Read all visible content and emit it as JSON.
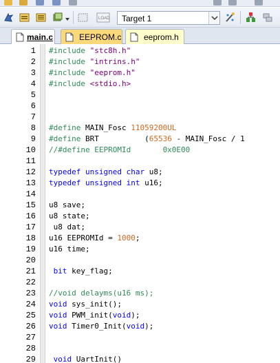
{
  "toolbar": {
    "target": "Target 1"
  },
  "tabs": [
    {
      "label": "main.c",
      "active": true
    },
    {
      "label": "EEPROM.c",
      "active": false
    },
    {
      "label": "eeprom.h",
      "active": false
    }
  ],
  "editor": {
    "lines": [
      {
        "n": "1",
        "tokens": [
          [
            "directive",
            "#include "
          ],
          [
            "string",
            "\"stc8h.h\""
          ]
        ]
      },
      {
        "n": "2",
        "tokens": [
          [
            "directive",
            "#include "
          ],
          [
            "string",
            "\"intrins.h\""
          ]
        ]
      },
      {
        "n": "3",
        "tokens": [
          [
            "directive",
            "#include "
          ],
          [
            "string",
            "\"eeprom.h\""
          ]
        ]
      },
      {
        "n": "4",
        "tokens": [
          [
            "directive",
            "#include "
          ],
          [
            "string",
            "<stdio.h>"
          ]
        ]
      },
      {
        "n": "5",
        "tokens": []
      },
      {
        "n": "6",
        "tokens": []
      },
      {
        "n": "7",
        "tokens": []
      },
      {
        "n": "8",
        "tokens": [
          [
            "directive",
            "#define "
          ],
          [
            "plain",
            "MAIN_Fosc "
          ],
          [
            "number",
            "11059200UL"
          ]
        ]
      },
      {
        "n": "9",
        "tokens": [
          [
            "directive",
            "#define "
          ],
          [
            "plain",
            "BRT          ("
          ],
          [
            "number",
            "65536"
          ],
          [
            "plain",
            " - MAIN_Fosc / 1"
          ]
        ]
      },
      {
        "n": "10",
        "tokens": [
          [
            "comment",
            "//#define EEPROMId       0x0E00"
          ]
        ]
      },
      {
        "n": "11",
        "tokens": []
      },
      {
        "n": "12",
        "tokens": [
          [
            "keyword",
            "typedef unsigned char "
          ],
          [
            "plain",
            "u8;"
          ]
        ]
      },
      {
        "n": "13",
        "tokens": [
          [
            "keyword",
            "typedef unsigned int "
          ],
          [
            "plain",
            "u16;"
          ]
        ]
      },
      {
        "n": "14",
        "tokens": []
      },
      {
        "n": "15",
        "tokens": [
          [
            "plain",
            "u8 save;"
          ]
        ]
      },
      {
        "n": "16",
        "tokens": [
          [
            "plain",
            "u8 state;"
          ]
        ]
      },
      {
        "n": "17",
        "tokens": [
          [
            "plain",
            " u8 dat;"
          ]
        ]
      },
      {
        "n": "18",
        "tokens": [
          [
            "plain",
            "u16 EEPROMId = "
          ],
          [
            "number",
            "1000"
          ],
          [
            "plain",
            ";"
          ]
        ]
      },
      {
        "n": "19",
        "tokens": [
          [
            "plain",
            "u16 time;"
          ]
        ]
      },
      {
        "n": "20",
        "tokens": []
      },
      {
        "n": "21",
        "tokens": [
          [
            "keyword",
            " bit "
          ],
          [
            "plain",
            "key_flag;"
          ]
        ]
      },
      {
        "n": "22",
        "tokens": []
      },
      {
        "n": "23",
        "tokens": [
          [
            "comment",
            "//void delayms(u16 ms);"
          ]
        ]
      },
      {
        "n": "24",
        "tokens": [
          [
            "keyword",
            "void "
          ],
          [
            "plain",
            "sys_init();"
          ]
        ]
      },
      {
        "n": "25",
        "tokens": [
          [
            "keyword",
            "void "
          ],
          [
            "plain",
            "PWM_init("
          ],
          [
            "keyword",
            "void"
          ],
          [
            "plain",
            ");"
          ]
        ]
      },
      {
        "n": "26",
        "tokens": [
          [
            "keyword",
            "void "
          ],
          [
            "plain",
            "Timer0_Init("
          ],
          [
            "keyword",
            "void"
          ],
          [
            "plain",
            ");"
          ]
        ]
      },
      {
        "n": "27",
        "tokens": []
      },
      {
        "n": "28",
        "tokens": []
      },
      {
        "n": "29",
        "tokens": [
          [
            "keyword",
            " void "
          ],
          [
            "plain",
            "UartInit()"
          ]
        ]
      }
    ]
  }
}
